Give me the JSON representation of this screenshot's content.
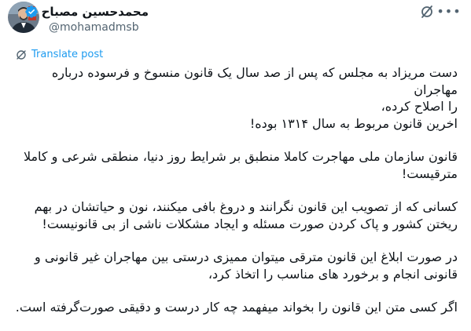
{
  "author": {
    "display_name": "محمدحسین مصباح",
    "handle": "@mohamadmsb",
    "verified": true,
    "avatar_icon": "person-avatar"
  },
  "header_icons": {
    "grok": "grok-icon",
    "more": "more-icon",
    "more_glyph": "•••"
  },
  "translate": {
    "label": "Translate post",
    "icon": "translate-icon"
  },
  "tweet": {
    "para1_line1": "دست مریزاد به مجلس که پس از صد سال یک قانون منسوخ و فرسوده درباره مهاجران",
    "para1_line2": "را اصلاح کرده،",
    "para1_line3": "اخرین قانون مربوط به سال ۱۳۱۴ بوده!",
    "para2_line1": "قانون سازمان ملی مهاجرت کاملا منطبق بر شرایط روز دنیا، منطقی شرعی و کاملا",
    "para2_line2": "مترقیست!",
    "para3_line1": "کسانی که از تصویب این قانون نگرانند و دروغ بافی میکنند، نون و حیاتشان در بهم",
    "para3_line2": "ریختن کشور و پاک کردن صورت مسئله و ایجاد مشکلات ناشی از بی قانونیست!",
    "para4_line1": "در صورت ابلاغ این قانون مترقی میتوان ممیزی درستی بین مهاجران غیر قانونی و",
    "para4_line2": "قانونی انجام و برخورد های مناسب را اتخاذ کرد،",
    "para5_line1": "اگر کسی متن این قانون را بخواند میفهمد چه کار درست و دقیقی صورت‌گرفته است."
  },
  "colors": {
    "text": "#0f1419",
    "secondary": "#536471",
    "link": "#1d9bf0",
    "verified": "#1d9bf0"
  }
}
